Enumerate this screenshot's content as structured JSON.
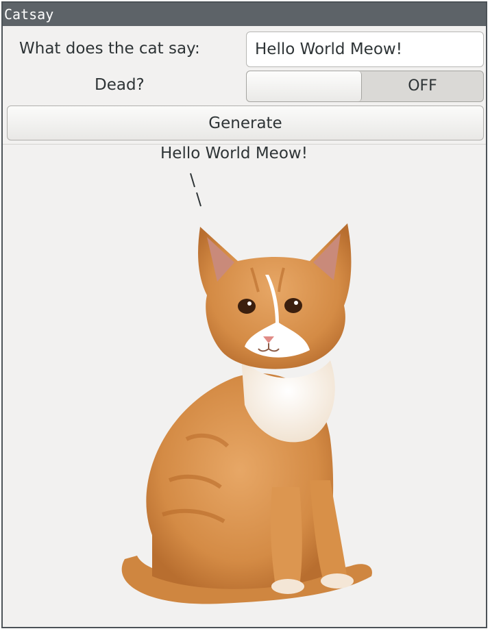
{
  "window": {
    "title": "Catsay"
  },
  "form": {
    "say_label": "What does the cat say:",
    "say_value": "Hello World Meow!",
    "dead_label": "Dead?",
    "dead_state": "OFF",
    "generate_label": "Generate"
  },
  "output": {
    "speech": "Hello World Meow!",
    "image_icon": "cat-image"
  }
}
